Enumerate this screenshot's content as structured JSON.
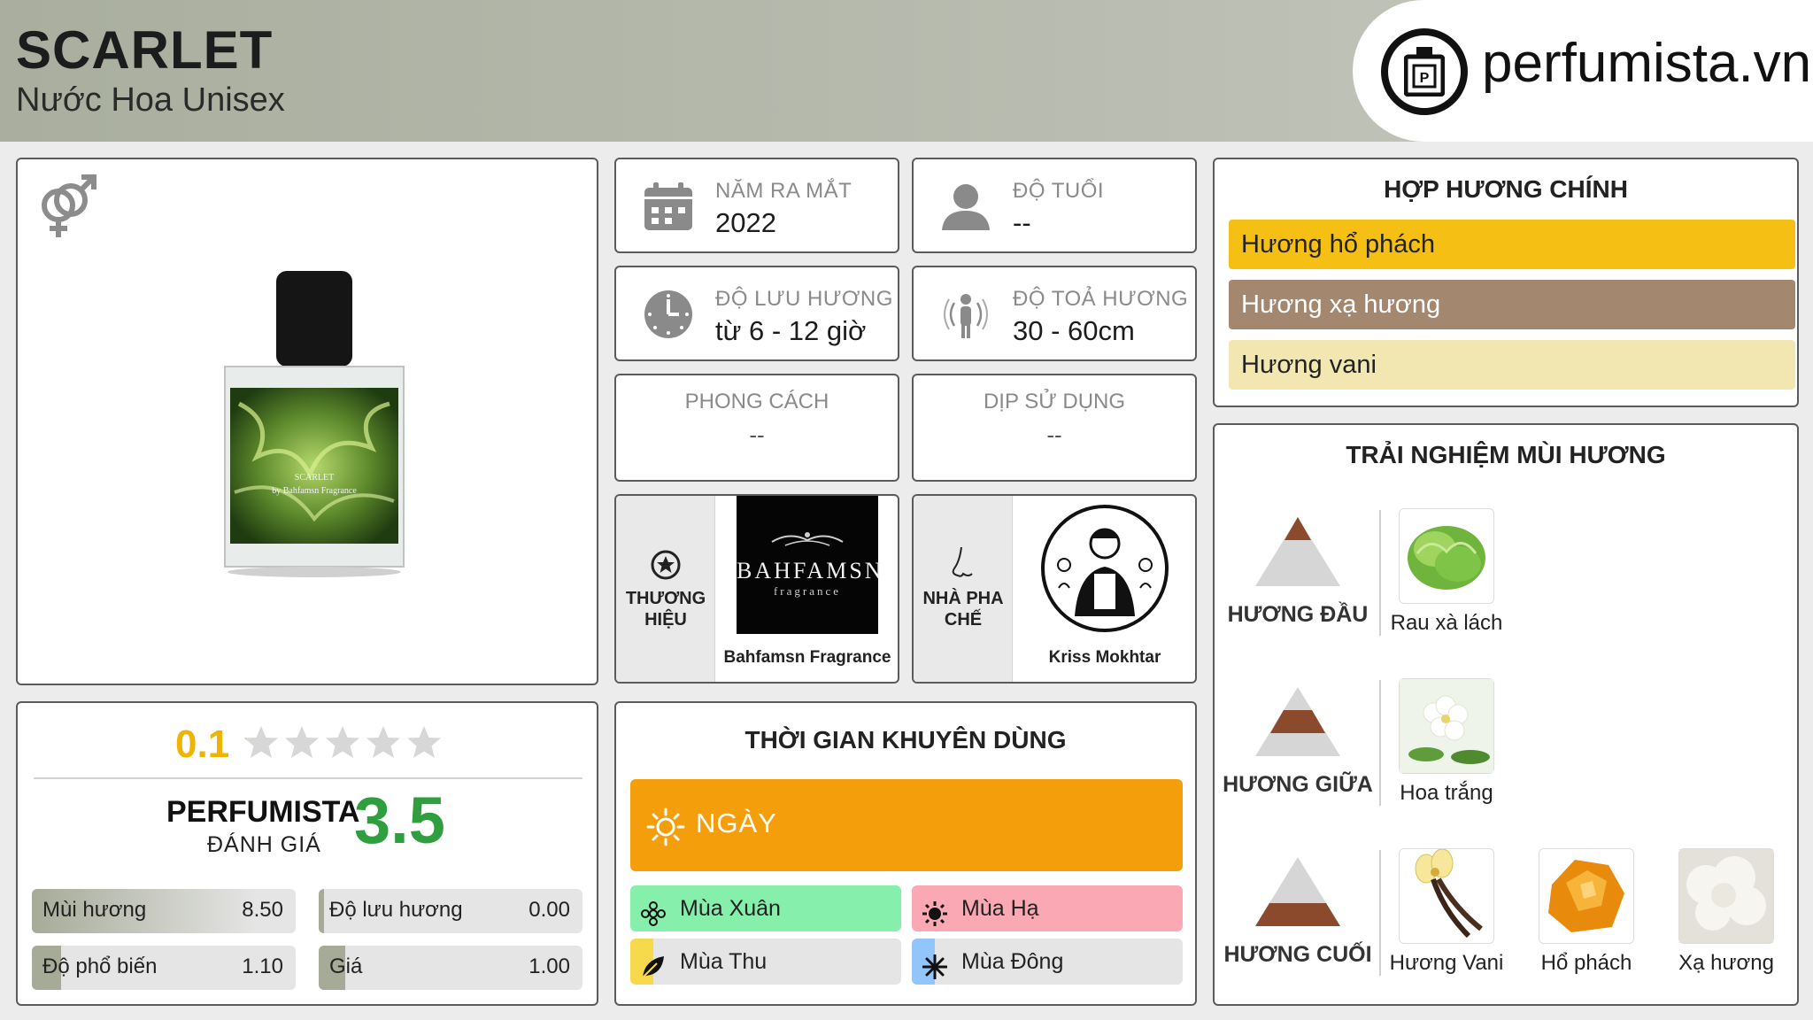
{
  "header": {
    "title": "SCARLET",
    "subtitle": "Nước Hoa Unisex",
    "logo_text": "perfumista.vn",
    "logo_icon": "perfume-bottle-logo-icon"
  },
  "product": {
    "gender_icon": "unisex-gender-icon",
    "bottle_label_line1": "SCARLET",
    "bottle_label_line2": "by Bahfamsn Fragrance"
  },
  "info": {
    "release_year": {
      "label": "NĂM RA MẮT",
      "value": "2022",
      "icon": "calendar-icon"
    },
    "age": {
      "label": "ĐỘ TUỔI",
      "value": "--",
      "icon": "person-icon"
    },
    "longevity": {
      "label": "ĐỘ LƯU HƯƠNG",
      "value": "từ 6 - 12 giờ",
      "icon": "clock-icon"
    },
    "sillage": {
      "label": "ĐỘ TOẢ HƯƠNG",
      "value": "30 - 60cm",
      "icon": "sillage-person-icon"
    },
    "style": {
      "label": "PHONG CÁCH",
      "value": "--"
    },
    "occasion": {
      "label": "DỊP SỬ DỤNG",
      "value": "--"
    },
    "brand": {
      "label": "THƯƠNG HIỆU",
      "name": "Bahfamsn Fragrance",
      "logo_text": "BAHFAMSN",
      "logo_sub": "fragrance",
      "icon": "star-badge-icon"
    },
    "perfumer": {
      "label": "NHÀ PHA CHẾ",
      "name": "Kriss Mokhtar",
      "icon": "nose-icon"
    }
  },
  "rating": {
    "user_score": "0.1",
    "stars_total": 5,
    "user_stars_fraction": 0.02,
    "perfumista_label": "PERFUMISTA",
    "perfumista_sub": "ĐÁNH GIÁ",
    "perfumista_score": "3.5",
    "metrics": [
      {
        "name": "Mùi hương",
        "value": "8.50",
        "fraction": 0.85
      },
      {
        "name": "Độ lưu hương",
        "value": "0.00",
        "fraction": 0.0
      },
      {
        "name": "Độ phổ biến",
        "value": "1.10",
        "fraction": 0.11
      },
      {
        "name": "Giá",
        "value": "1.00",
        "fraction": 0.1
      }
    ]
  },
  "usage_time": {
    "title": "THỜI GIAN KHUYÊN DÙNG",
    "day_label": "NGÀY",
    "day_icon": "sun-outline-icon",
    "seasons": [
      {
        "label": "Mùa Xuân",
        "icon": "flower-icon",
        "color": "#86efac"
      },
      {
        "label": "Mùa Hạ",
        "icon": "sun-icon",
        "color": "#f9a8b4"
      },
      {
        "label": "Mùa Thu",
        "icon": "leaf-icon",
        "color": "#f7d94c"
      },
      {
        "label": "Mùa Đông",
        "icon": "snowflake-icon",
        "color": "#93c5fd"
      }
    ]
  },
  "main_accords": {
    "title": "HỢP HƯƠNG CHÍNH",
    "items": [
      {
        "label": "Hương hổ phách",
        "color": "#f5bf14"
      },
      {
        "label": "Hương xạ hương",
        "color": "#a4876f"
      },
      {
        "label": "Hương vani",
        "color": "#f2e6b1"
      }
    ]
  },
  "notes": {
    "title": "TRẢI NGHIỆM MÙI HƯƠNG",
    "top": {
      "label": "HƯƠNG ĐẦU",
      "items": [
        "Rau xà lách"
      ]
    },
    "middle": {
      "label": "HƯƠNG GIỮA",
      "items": [
        "Hoa trắng"
      ]
    },
    "base": {
      "label": "HƯƠNG CUỐI",
      "items": [
        "Hương Vani",
        "Hổ phách",
        "Xạ hương"
      ]
    }
  },
  "colors": {
    "accent_green": "#2e9e3e",
    "accent_gold": "#f0b400",
    "day_orange": "#f59e0b"
  }
}
